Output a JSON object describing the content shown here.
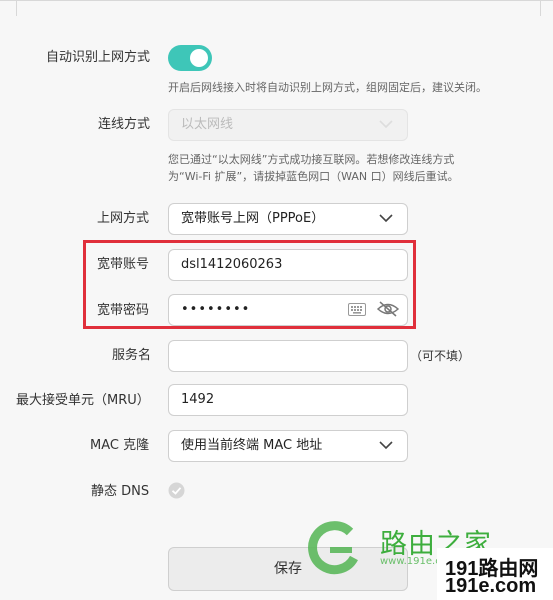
{
  "auto_detect": {
    "label": "自动识别上网方式",
    "enabled": true,
    "hint": "开启后网线接入时将自动识别上网方式，组网固定后，建议关闭。"
  },
  "connection_type": {
    "label": "连线方式",
    "value": "以太网线",
    "note_line1": "您已通过“以太网线”方式成功接互联网。若想修改连线方式",
    "note_line2": "为“Wi-Fi 扩展”，请拔掉蓝色网口（WAN 口）网线后重试。"
  },
  "internet_mode": {
    "label": "上网方式",
    "value": "宽带账号上网（PPPoE）"
  },
  "account": {
    "label": "宽带账号",
    "value": "dsl1412060263"
  },
  "password": {
    "label": "宽带密码",
    "value": "••••••••"
  },
  "service_name": {
    "label": "服务名",
    "value": "",
    "suffix": "（可不填）"
  },
  "mru": {
    "label": "最大接受单元（MRU）",
    "value": "1492"
  },
  "mac_clone": {
    "label": "MAC 克隆",
    "value": "使用当前终端 MAC 地址"
  },
  "static_dns": {
    "label": "静态 DNS",
    "checked": false
  },
  "save_label": "保存",
  "watermark": {
    "brand": "路由之家",
    "url": "www.191e.com",
    "badge_line1": "191路由网",
    "badge_line2": "191e.com"
  },
  "colors": {
    "toggle_on": "#3ec6b8",
    "highlight_box": "#e02f3b",
    "watermark_green": "#3dae3d"
  },
  "icons": [
    "chevron-down-icon",
    "keyboard-icon",
    "eye-icon",
    "check-circle-icon",
    "router-home-logo"
  ]
}
